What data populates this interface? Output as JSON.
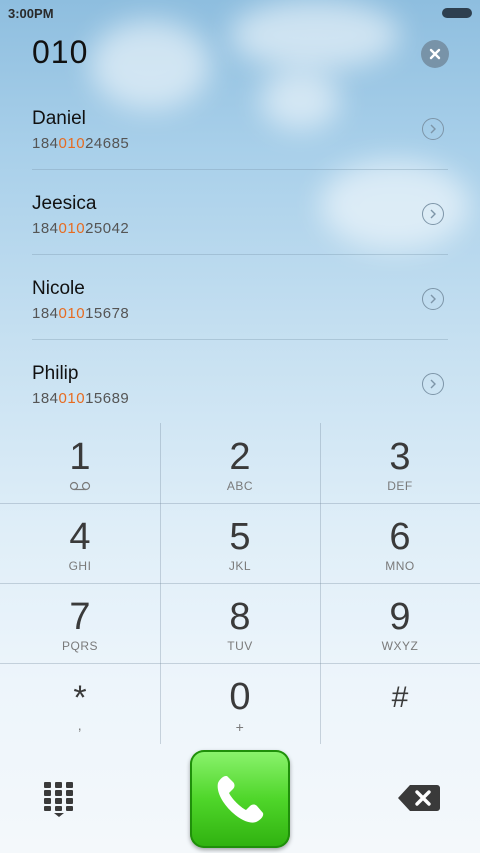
{
  "status_bar": {
    "time": "3:00PM"
  },
  "dialed": {
    "number": "010"
  },
  "contacts": [
    {
      "name": "Daniel",
      "number_prefix": "184",
      "number_match": "010",
      "number_suffix": "24685"
    },
    {
      "name": "Jeesica",
      "number_prefix": "184",
      "number_match": "010",
      "number_suffix": "25042"
    },
    {
      "name": "Nicole",
      "number_prefix": "184",
      "number_match": "010",
      "number_suffix": "15678"
    },
    {
      "name": "Philip",
      "number_prefix": "184",
      "number_match": "010",
      "number_suffix": "15689"
    }
  ],
  "keypad": {
    "keys": [
      {
        "digit": "1",
        "letters": ""
      },
      {
        "digit": "2",
        "letters": "ABC"
      },
      {
        "digit": "3",
        "letters": "DEF"
      },
      {
        "digit": "4",
        "letters": "GHI"
      },
      {
        "digit": "5",
        "letters": "JKL"
      },
      {
        "digit": "6",
        "letters": "MNO"
      },
      {
        "digit": "7",
        "letters": "PQRS"
      },
      {
        "digit": "8",
        "letters": "TUV"
      },
      {
        "digit": "9",
        "letters": "WXYZ"
      },
      {
        "digit": "*",
        "letters": ","
      },
      {
        "digit": "0",
        "letters": "+"
      },
      {
        "digit": "#",
        "letters": ""
      }
    ],
    "voicemail_icon": "voicemail-icon"
  },
  "bottom_bar": {
    "dialpad_icon": "dialpad-grid-icon",
    "call_icon": "phone-handset-icon",
    "backspace_icon": "backspace-icon"
  },
  "colors": {
    "match_highlight": "#e86b1f",
    "call_button": "#4fd62a"
  }
}
